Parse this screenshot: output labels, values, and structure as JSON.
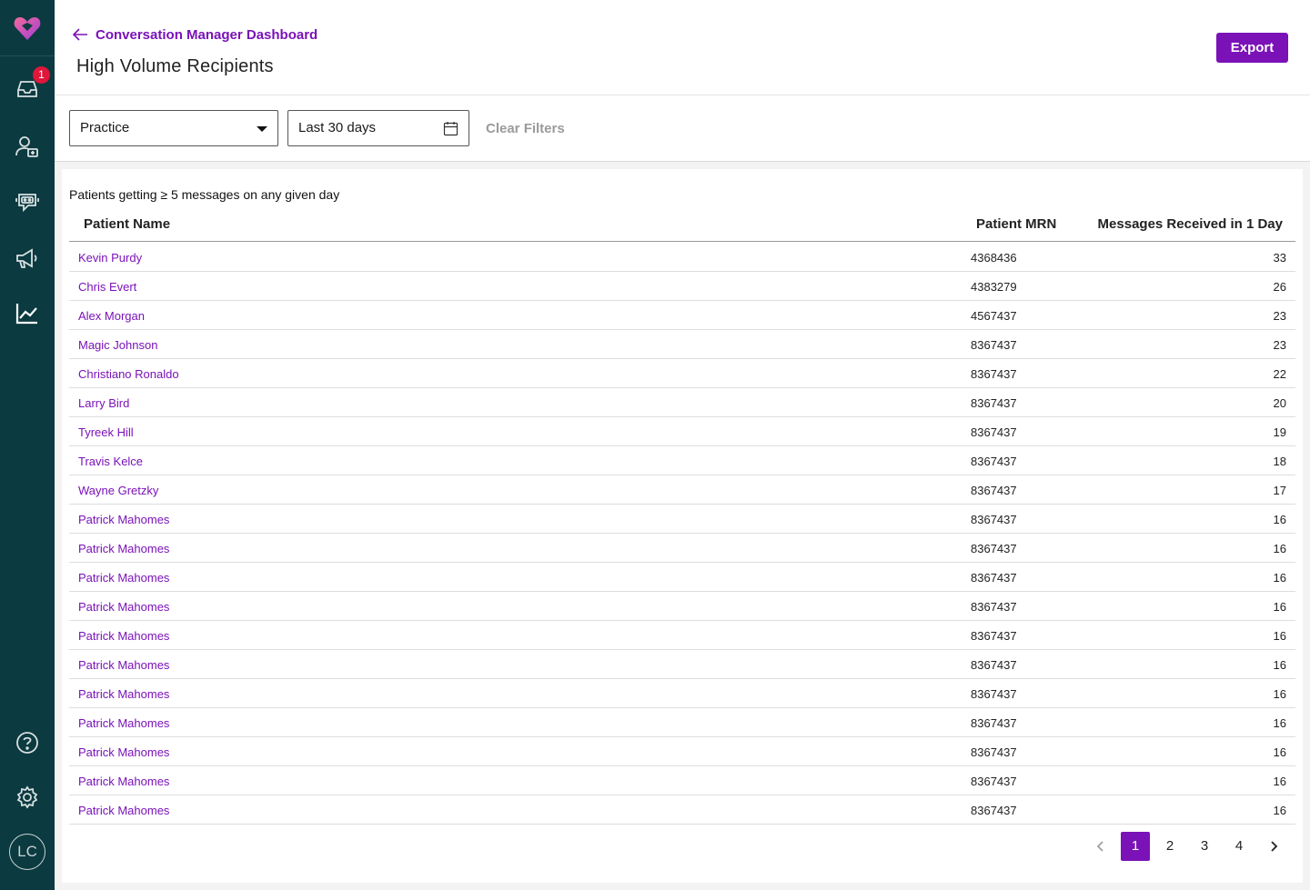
{
  "sidebar": {
    "inbox_badge": "1",
    "avatar_initials": "LC"
  },
  "header": {
    "back_link": "Conversation Manager Dashboard",
    "title": "High Volume Recipients",
    "export_label": "Export"
  },
  "filters": {
    "practice_value": "Practice",
    "date_value": "Last 30 days",
    "clear_label": "Clear Filters"
  },
  "table": {
    "caption": "Patients getting ≥ 5 messages on any given day",
    "columns": [
      "Patient Name",
      "Patient MRN",
      "Messages Received in 1 Day"
    ],
    "rows": [
      {
        "name": "Kevin Purdy",
        "mrn": "4368436",
        "count": "33"
      },
      {
        "name": "Chris Evert",
        "mrn": "4383279",
        "count": "26"
      },
      {
        "name": "Alex Morgan",
        "mrn": "4567437",
        "count": "23"
      },
      {
        "name": "Magic Johnson",
        "mrn": "8367437",
        "count": "23"
      },
      {
        "name": "Christiano Ronaldo",
        "mrn": "8367437",
        "count": "22"
      },
      {
        "name": "Larry Bird",
        "mrn": "8367437",
        "count": "20"
      },
      {
        "name": "Tyreek Hill",
        "mrn": "8367437",
        "count": "19"
      },
      {
        "name": "Travis Kelce",
        "mrn": "8367437",
        "count": "18"
      },
      {
        "name": "Wayne Gretzky",
        "mrn": "8367437",
        "count": "17"
      },
      {
        "name": "Patrick Mahomes",
        "mrn": "8367437",
        "count": "16"
      },
      {
        "name": "Patrick Mahomes",
        "mrn": "8367437",
        "count": "16"
      },
      {
        "name": "Patrick Mahomes",
        "mrn": "8367437",
        "count": "16"
      },
      {
        "name": "Patrick Mahomes",
        "mrn": "8367437",
        "count": "16"
      },
      {
        "name": "Patrick Mahomes",
        "mrn": "8367437",
        "count": "16"
      },
      {
        "name": "Patrick Mahomes",
        "mrn": "8367437",
        "count": "16"
      },
      {
        "name": "Patrick Mahomes",
        "mrn": "8367437",
        "count": "16"
      },
      {
        "name": "Patrick Mahomes",
        "mrn": "8367437",
        "count": "16"
      },
      {
        "name": "Patrick Mahomes",
        "mrn": "8367437",
        "count": "16"
      },
      {
        "name": "Patrick Mahomes",
        "mrn": "8367437",
        "count": "16"
      },
      {
        "name": "Patrick Mahomes",
        "mrn": "8367437",
        "count": "16"
      }
    ]
  },
  "pagination": {
    "pages": [
      "1",
      "2",
      "3",
      "4"
    ],
    "current": "1"
  },
  "colors": {
    "sidebar": "#0b3a40",
    "accent": "#7a12b8",
    "badge": "#e0163a"
  },
  "icons": [
    "logo-icon",
    "inbox-icon",
    "add-user-icon",
    "bot-icon",
    "megaphone-icon",
    "chart-icon",
    "help-icon",
    "gear-icon",
    "arrow-left-icon",
    "calendar-icon",
    "caret-down-icon",
    "chevron-left-icon",
    "chevron-right-icon"
  ]
}
